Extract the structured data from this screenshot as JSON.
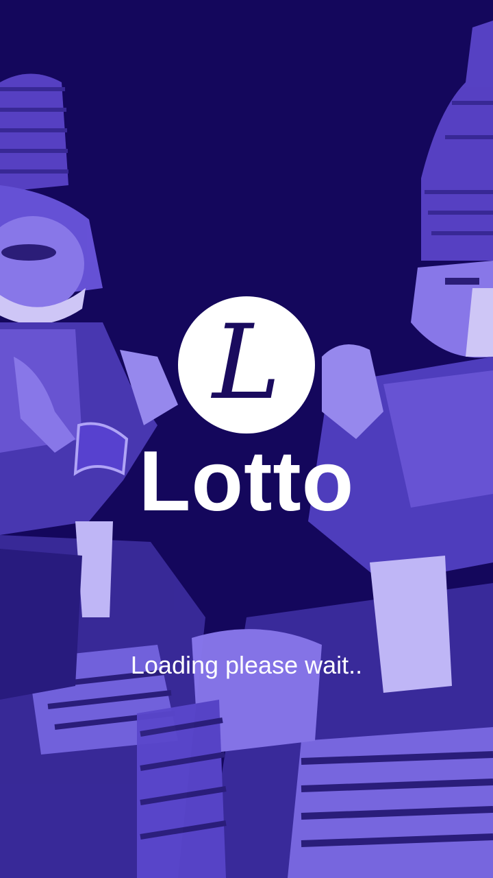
{
  "splash": {
    "logo_letter": "L",
    "app_title": "Lotto",
    "loading_text": "Loading please wait.."
  },
  "colors": {
    "background": "#14075c",
    "overlay_purple": "#5b45d6",
    "logo_circle": "#ffffff",
    "logo_letter": "#1a0b5e",
    "text": "#ffffff"
  },
  "icons": {
    "logo": "script-L-logo-icon"
  }
}
